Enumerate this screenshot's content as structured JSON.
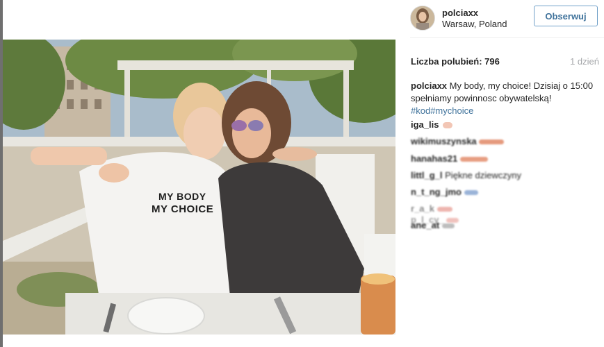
{
  "post": {
    "username": "polciaxx",
    "location": "Warsaw, Poland",
    "follow_label": "Obserwuj",
    "likes_text": "Liczba polubień: 796",
    "time": "1 dzień",
    "caption": {
      "user": "polciaxx",
      "text": " My body, my choice! Dzisiaj o 15:00 spełniamy powinnosc obywatelską! ",
      "hashtags": "#kod#mychoice"
    },
    "comments": [
      {
        "user": "iga_lis"
      },
      {
        "user": "wikimuszynska"
      },
      {
        "user": "hanahas21"
      },
      {
        "user": "littl_g_l",
        "text": "Piękne dziewczyny"
      },
      {
        "user": "n_t_ng_jmo"
      },
      {
        "user": "r_a_k"
      },
      {
        "user": "p_l_cy_"
      },
      {
        "user": "ane_at"
      }
    ],
    "shirt_text": [
      "MY BODY",
      "MY CHOICE"
    ]
  }
}
